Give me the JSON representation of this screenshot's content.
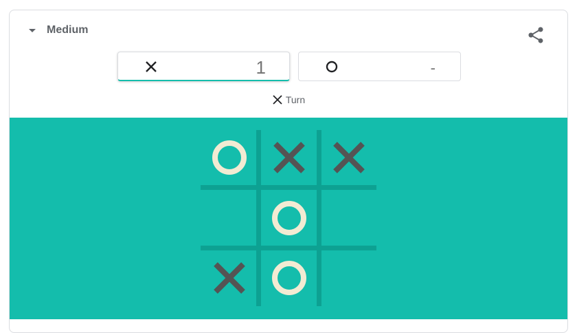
{
  "header": {
    "difficulty": "Medium",
    "share_icon": "share-icon"
  },
  "score": {
    "x_player": {
      "symbol": "X",
      "value": "1",
      "active": true
    },
    "o_player": {
      "symbol": "O",
      "value": "-",
      "active": false
    }
  },
  "turn": {
    "symbol": "X",
    "label": "Turn"
  },
  "board": {
    "cells": [
      [
        "O",
        "X",
        "X"
      ],
      [
        "",
        "O",
        ""
      ],
      [
        "X",
        "O",
        ""
      ]
    ]
  },
  "colors": {
    "board_bg": "#14bdac",
    "grid_line": "#0da192",
    "x_mark": "#545454",
    "o_mark": "#f2ebd3",
    "accent": "#14bdac",
    "text": "#5f6368"
  }
}
